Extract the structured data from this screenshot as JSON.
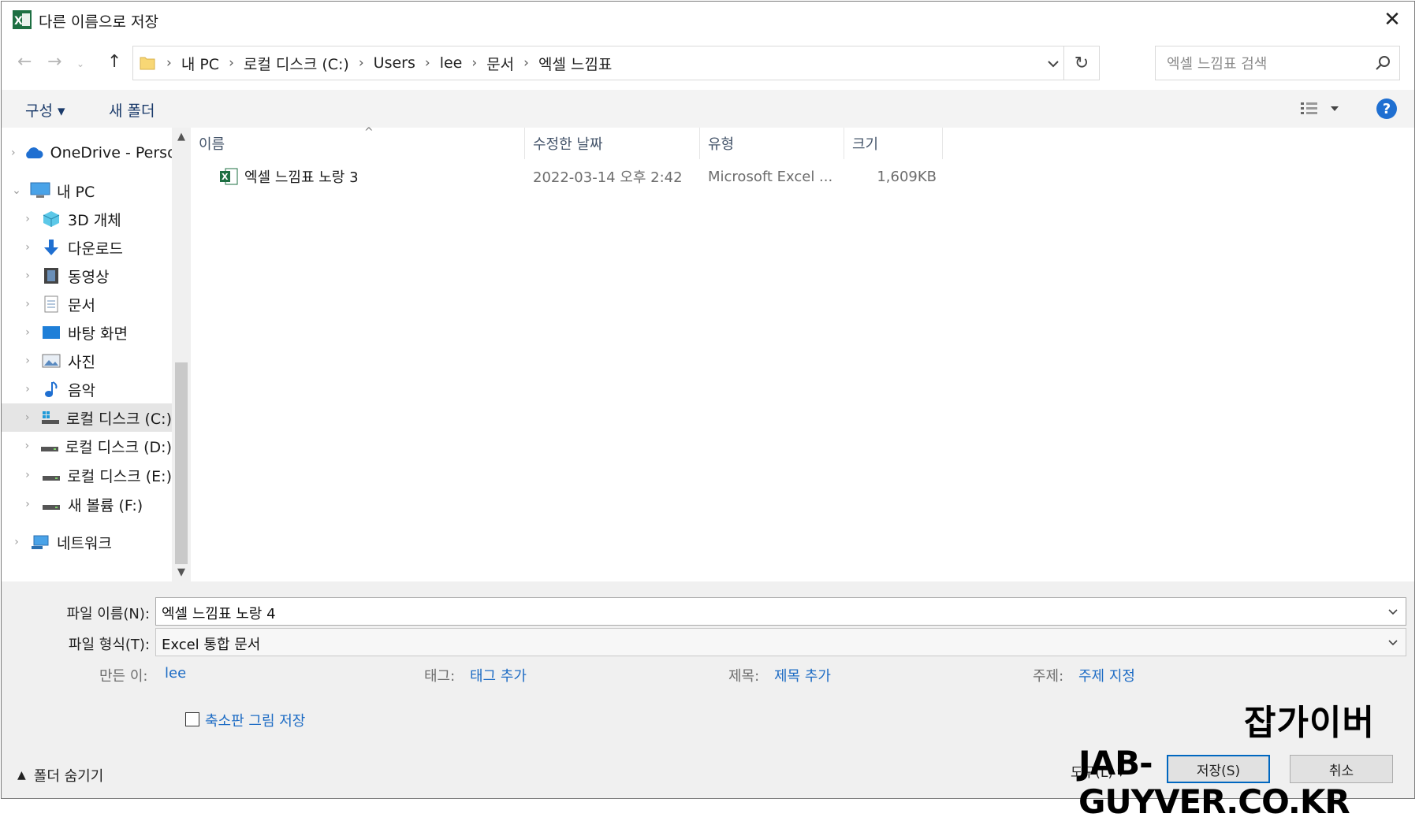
{
  "window": {
    "title": "다른 이름으로 저장",
    "close_label": "✕"
  },
  "nav": {
    "breadcrumbs": [
      "내 PC",
      "로컬 디스크 (C:)",
      "Users",
      "lee",
      "문서",
      "엑셀 느낌표"
    ],
    "search_placeholder": "엑셀 느낌표 검색",
    "refresh_label": "↻"
  },
  "toolbar": {
    "organize_label": "구성 ▾",
    "new_folder_label": "새 폴더",
    "help_label": "?"
  },
  "sidebar": {
    "items": [
      {
        "label": "OneDrive - Personal",
        "icon": "cloud-icon"
      },
      {
        "label": "내 PC",
        "icon": "computer-icon"
      },
      {
        "label": "3D 개체",
        "icon": "cube-icon"
      },
      {
        "label": "다운로드",
        "icon": "download-icon"
      },
      {
        "label": "동영상",
        "icon": "video-icon"
      },
      {
        "label": "문서",
        "icon": "document-icon"
      },
      {
        "label": "바탕 화면",
        "icon": "desktop-icon"
      },
      {
        "label": "사진",
        "icon": "pictures-icon"
      },
      {
        "label": "음악",
        "icon": "music-icon"
      },
      {
        "label": "로컬 디스크 (C:)",
        "icon": "drive-icon"
      },
      {
        "label": "로컬 디스크 (D:)",
        "icon": "drive-icon"
      },
      {
        "label": "로컬 디스크 (E:)",
        "icon": "drive-icon"
      },
      {
        "label": "새 볼륨 (F:)",
        "icon": "drive-icon"
      },
      {
        "label": "네트워크",
        "icon": "network-icon"
      }
    ],
    "selected_index": 9
  },
  "filelist": {
    "columns": [
      "이름",
      "수정한 날짜",
      "유형",
      "크기"
    ],
    "rows": [
      {
        "name": "엑셀 느낌표 노랑 3",
        "modified": "2022-03-14 오후 2:42",
        "type": "Microsoft Excel ...",
        "size": "1,609KB"
      }
    ]
  },
  "save": {
    "filename_label": "파일 이름(N):",
    "filename_value": "엑셀 느낌표 노랑 4",
    "filetype_label": "파일 형식(T):",
    "filetype_value": "Excel 통합 문서",
    "author_label": "만든 이:",
    "author_value": "lee",
    "tags_label": "태그:",
    "tags_value": "태그 추가",
    "title_label": "제목:",
    "title_value": "제목 추가",
    "subject_label": "주제:",
    "subject_value": "주제 지정",
    "thumbnail_label": "축소판 그림 저장",
    "thumbnail_checked": false,
    "hide_folders_label": "폴더 숨기기",
    "tools_label": "도구(L) ▾",
    "save_button": "저장(S)",
    "cancel_button": "취소"
  },
  "watermark": {
    "line1": "잡가이버",
    "line2": "JAB-GUYVER.CO.KR"
  },
  "colors": {
    "accent": "#0067c0",
    "link": "#1c6bc4",
    "excel_green": "#1d6f42",
    "folder_yellow": "#f8d775"
  }
}
